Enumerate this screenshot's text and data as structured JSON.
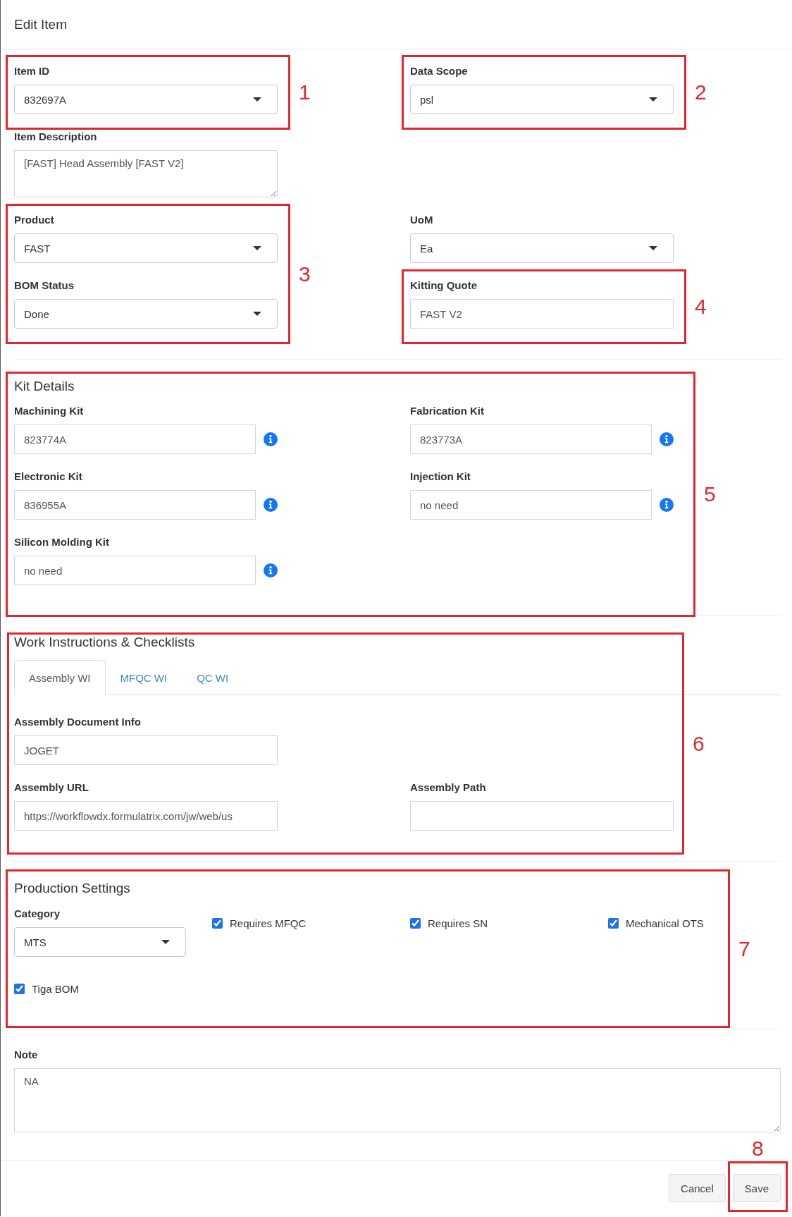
{
  "header": {
    "title": "Edit Item"
  },
  "general": {
    "rows": [
      {
        "cells": [
          {
            "fields": [
              {
                "kind": "select",
                "label": "Item ID",
                "value": "832697A"
              }
            ],
            "annotation": "1"
          },
          {
            "fields": [
              {
                "kind": "select",
                "label": "Data Scope",
                "value": "psl"
              }
            ],
            "annotation": "2"
          }
        ]
      },
      {
        "cells": [
          {
            "fields": [
              {
                "kind": "textarea",
                "label": "Item Description",
                "value": "[FAST] Head Assembly [FAST V2]"
              }
            ]
          }
        ]
      },
      {
        "cells": [
          {
            "fields": [
              {
                "kind": "select",
                "label": "Product",
                "value": "FAST"
              },
              {
                "kind": "select",
                "label": "BOM Status",
                "value": "Done"
              }
            ],
            "annotation": "3"
          },
          {
            "fields": [
              {
                "kind": "select",
                "label": "UoM",
                "value": "Ea"
              },
              {
                "kind": "text",
                "label": "Kitting Quote",
                "value": "FAST V2",
                "annotation": "4"
              }
            ]
          }
        ]
      }
    ]
  },
  "kit_details": {
    "title": "Kit Details",
    "annotation": "5",
    "fields": [
      {
        "label": "Machining Kit",
        "value": "823774A"
      },
      {
        "label": "Fabrication Kit",
        "value": "823773A"
      },
      {
        "label": "Electronic Kit",
        "value": "836955A"
      },
      {
        "label": "Injection Kit",
        "value": "no need"
      },
      {
        "label": "Silicon Molding Kit",
        "value": "no need"
      }
    ]
  },
  "work_instructions": {
    "title": "Work Instructions & Checklists",
    "annotation": "6",
    "tabs": [
      {
        "label": "Assembly WI",
        "selected": true
      },
      {
        "label": "MFQC WI",
        "selected": false
      },
      {
        "label": "QC WI",
        "selected": false
      }
    ],
    "rows": [
      {
        "cells": [
          {
            "fields": [
              {
                "kind": "text",
                "label": "Assembly Document Info",
                "value": "JOGET"
              }
            ]
          }
        ]
      },
      {
        "cells": [
          {
            "fields": [
              {
                "kind": "text",
                "label": "Assembly URL",
                "value": "https://workflowdx.formulatrix.com/jw/web/us"
              }
            ]
          },
          {
            "fields": [
              {
                "kind": "text",
                "label": "Assembly Path"
              }
            ]
          }
        ]
      }
    ]
  },
  "production_settings": {
    "title": "Production Settings",
    "annotation": "7",
    "category": {
      "kind": "select",
      "label": "Category",
      "value": "MTS"
    },
    "checkboxes": [
      {
        "label": "Requires MFQC",
        "checked": true
      },
      {
        "label": "Requires SN",
        "checked": true
      },
      {
        "label": "Mechanical OTS",
        "checked": true
      },
      {
        "label": "Tiga BOM",
        "checked": true
      }
    ]
  },
  "note": {
    "kind": "textarea",
    "label": "Note",
    "value": "NA"
  },
  "footer": {
    "buttons": [
      {
        "label": "Cancel"
      },
      {
        "label": "Save",
        "annotation": "8"
      }
    ]
  }
}
